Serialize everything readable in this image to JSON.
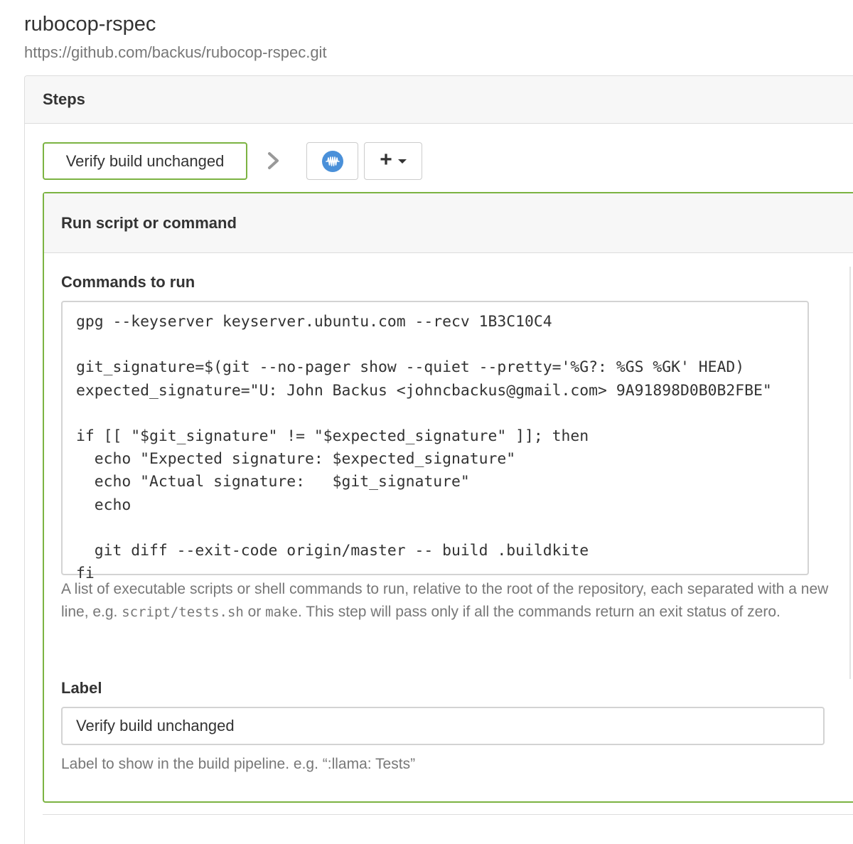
{
  "pipeline": {
    "name": "rubocop-rspec",
    "repo_url": "https://github.com/backus/rubocop-rspec.git"
  },
  "steps_panel": {
    "title": "Steps",
    "step_chip_label": "Verify build unchanged",
    "wait_icon": "waveform-icon",
    "add_icon": "plus-icon"
  },
  "step_editor": {
    "title": "Run script or command",
    "commands_label": "Commands to run",
    "commands_value": "gpg --keyserver keyserver.ubuntu.com --recv 1B3C10C4\n\ngit_signature=$(git --no-pager show --quiet --pretty='%G?: %GS %GK' HEAD)\nexpected_signature=\"U: John Backus <johncbackus@gmail.com> 9A91898D0B0B2FBE\"\n\nif [[ \"$git_signature\" != \"$expected_signature\" ]]; then\n  echo \"Expected signature: $expected_signature\"\n  echo \"Actual signature:   $git_signature\"\n  echo\n\n  git diff --exit-code origin/master -- build .buildkite\nfi",
    "commands_help": {
      "part1": "A list of executable scripts or shell commands to run, relative to the root of the repository, each separated with a new line, e.g. ",
      "code1": "script/tests.sh",
      "part2": " or ",
      "code2": "make",
      "part3": ". This step will pass only if all the commands return an exit status of zero."
    },
    "label_field_label": "Label",
    "label_value": "Verify build unchanged",
    "label_help": "Label to show in the build pipeline. e.g. “:llama: Tests”"
  },
  "colors": {
    "accent_green": "#7cb342",
    "wait_icon_blue": "#4a90d9"
  }
}
